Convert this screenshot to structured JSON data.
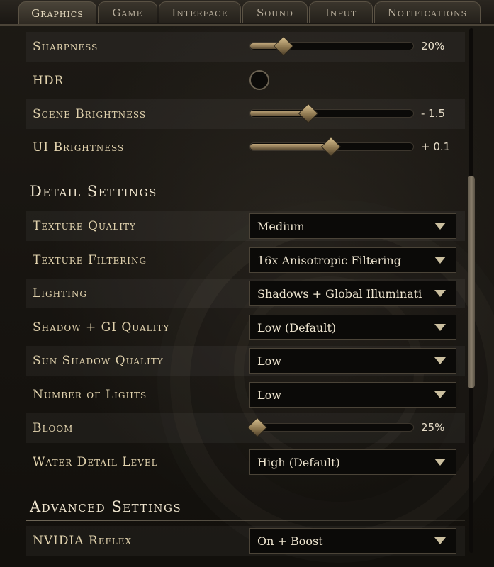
{
  "tabs": [
    {
      "label": "Graphics",
      "active": true
    },
    {
      "label": "Game",
      "active": false
    },
    {
      "label": "Interface",
      "active": false
    },
    {
      "label": "Sound",
      "active": false
    },
    {
      "label": "Input",
      "active": false
    },
    {
      "label": "Notifications",
      "active": false
    }
  ],
  "display_rows": [
    {
      "label": "Sharpness",
      "control": "slider",
      "value": "20%",
      "level": 0.2
    },
    {
      "label": "HDR",
      "control": "toggle",
      "enabled": false
    },
    {
      "label": "Scene Brightness",
      "control": "slider",
      "value": "- 1.5",
      "level": 0.35
    },
    {
      "label": "UI Brightness",
      "control": "slider",
      "value": "+ 0.1",
      "level": 0.49
    }
  ],
  "detail_section": {
    "title": "Detail Settings",
    "rows": [
      {
        "label": "Texture Quality",
        "control": "dropdown",
        "value": "Medium"
      },
      {
        "label": "Texture Filtering",
        "control": "dropdown",
        "value": "16x Anisotropic Filtering"
      },
      {
        "label": "Lighting",
        "control": "dropdown",
        "value": "Shadows + Global Illuminati"
      },
      {
        "label": "Shadow + GI Quality",
        "control": "dropdown",
        "value": "Low (Default)"
      },
      {
        "label": "Sun Shadow Quality",
        "control": "dropdown",
        "value": "Low"
      },
      {
        "label": "Number of Lights",
        "control": "dropdown",
        "value": "Low"
      },
      {
        "label": "Bloom",
        "control": "slider",
        "value": "25%",
        "level": 0.04
      },
      {
        "label": "Water Detail Level",
        "control": "dropdown",
        "value": "High (Default)"
      }
    ]
  },
  "advanced_section": {
    "title": "Advanced Settings",
    "rows": [
      {
        "label": "NVIDIA Reflex",
        "control": "dropdown",
        "value": "On + Boost"
      }
    ]
  },
  "colors": {
    "label": "#e2d3ae",
    "accent_gold": "#bfa67a",
    "panel_bg": "#1a1713"
  }
}
